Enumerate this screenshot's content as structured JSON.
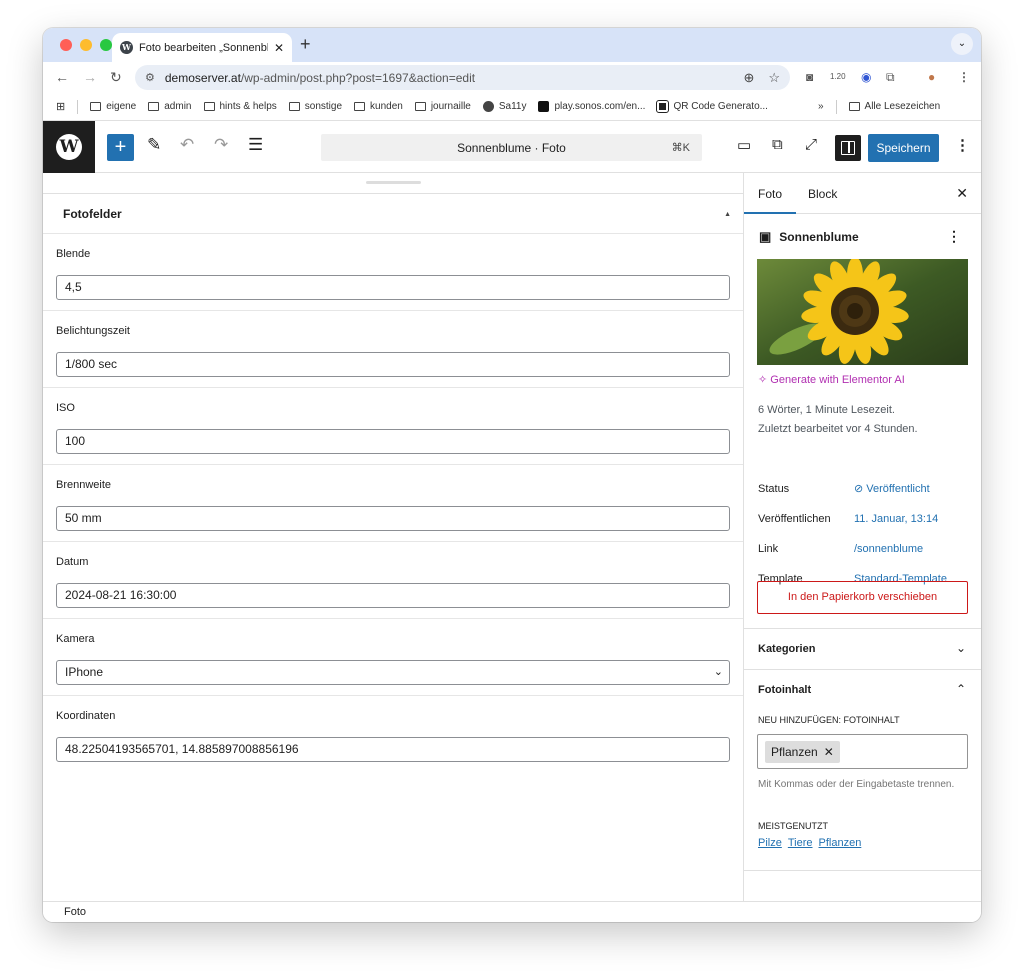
{
  "browser": {
    "tab_title": "Foto bearbeiten „Sonnenblume“",
    "tab_close": "✕",
    "new_tab": "+",
    "url_host": "demoserver.at",
    "url_path": "/wp-admin/post.php?post=1697&action=edit",
    "zoom_badge": "1.20",
    "bookmarks": [
      {
        "label": "eigene",
        "icon": "folder"
      },
      {
        "label": "admin",
        "icon": "folder"
      },
      {
        "label": "hints & helps",
        "icon": "folder"
      },
      {
        "label": "sonstige",
        "icon": "folder"
      },
      {
        "label": "kunden",
        "icon": "folder"
      },
      {
        "label": "journaille",
        "icon": "folder"
      },
      {
        "label": "Sa11y",
        "icon": "globe"
      },
      {
        "label": "play.sonos.com/en...",
        "icon": "sonos"
      },
      {
        "label": "QR Code Generato...",
        "icon": "qr"
      }
    ],
    "bookmarks_overflow": "»",
    "all_bookmarks": "Alle Lesezeichen"
  },
  "editor": {
    "command_title": "Sonnenblume · Foto",
    "command_shortcut": "⌘K",
    "save_label": "Speichern"
  },
  "metabox": {
    "title": "Fotofelder",
    "fields": [
      {
        "label": "Blende",
        "value": "4,5"
      },
      {
        "label": "Belichtungszeit",
        "value": "1/800 sec"
      },
      {
        "label": "ISO",
        "value": "100"
      },
      {
        "label": "Brennweite",
        "value": "50 mm"
      },
      {
        "label": "Datum",
        "value": "2024-08-21 16:30:00"
      },
      {
        "label": "Kamera",
        "value": "IPhone"
      },
      {
        "label": "Koordinaten",
        "value": "48.22504193565701, 14.885897008856196"
      }
    ]
  },
  "statusbar": {
    "label": "Foto"
  },
  "sidebar": {
    "tabs": [
      "Foto",
      "Block"
    ],
    "close": "✕",
    "post_title": "Sonnenblume",
    "ai_link": "Generate with Elementor AI",
    "meta_words": "6 Wörter, 1 Minute Lesezeit.",
    "meta_edited": "Zuletzt bearbeitet vor 4 Stunden.",
    "rows": [
      {
        "label": "Status",
        "value": "Veröffentlicht"
      },
      {
        "label": "Veröffentlichen",
        "value": "11. Januar, 13:14"
      },
      {
        "label": "Link",
        "value": "/sonnenblume"
      },
      {
        "label": "Template",
        "value": "Standard-Template"
      }
    ],
    "trash": "In den Papierkorb verschieben",
    "categories": "Kategorien",
    "content_panel": "Fotoinhalt",
    "add_new": "NEU HINZUFÜGEN: FOTOINHALT",
    "token": "Pflanzen",
    "help": "Mit Kommas oder der Eingabetaste trennen.",
    "most_used": "MEISTGENUTZT",
    "most_used_links": [
      "Pilze",
      "Tiere",
      "Pflanzen"
    ]
  },
  "colors": {
    "accent": "#2271b1",
    "danger": "#cc1818",
    "ai": "#b12fb1",
    "chrome": "#d7e3f8"
  }
}
